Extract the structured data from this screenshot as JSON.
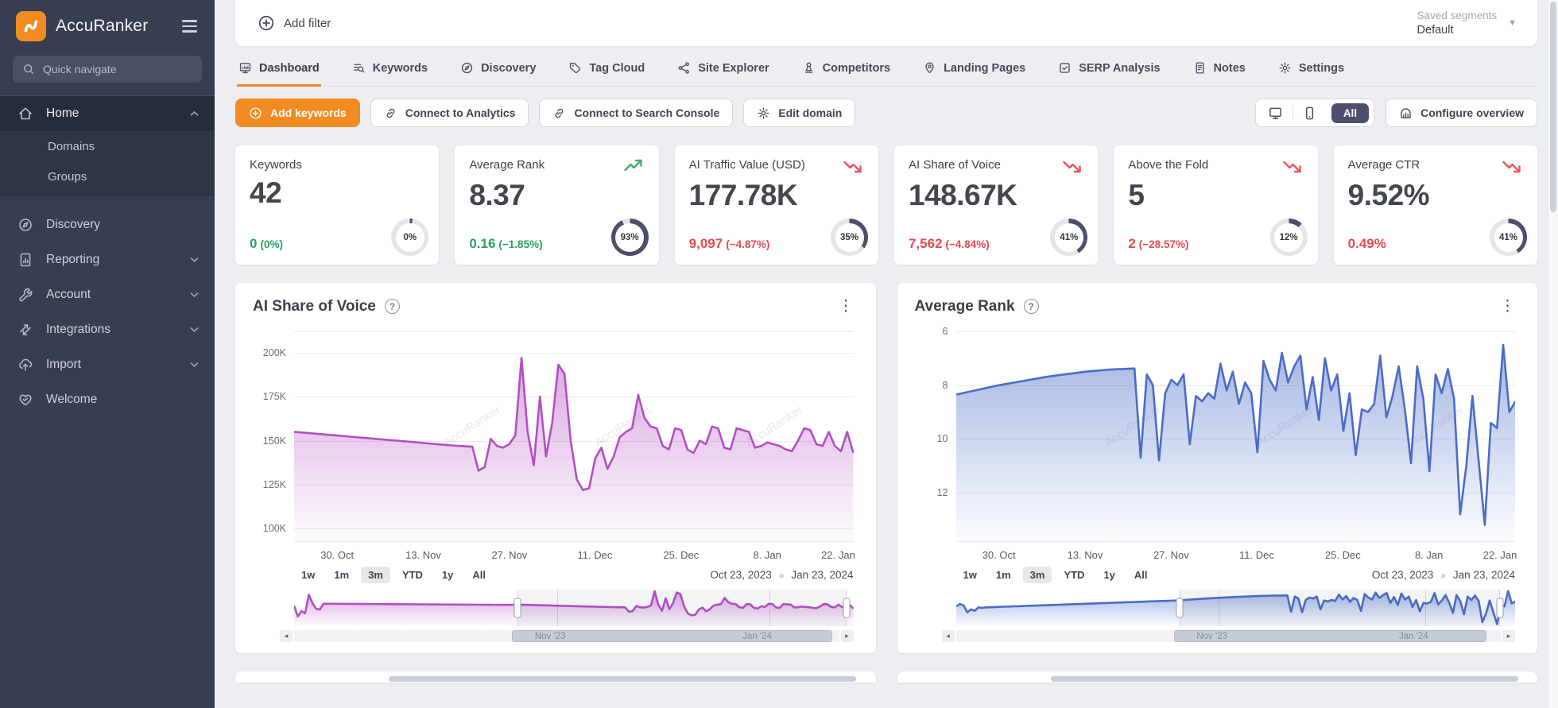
{
  "app": {
    "name": "AccuRanker"
  },
  "colors": {
    "accent_orange": "#f28b21",
    "underline_orange": "#f0861d",
    "navy": "#4b4f6b",
    "green": "#27a163",
    "red": "#e8484f",
    "purple": "#b44fc4",
    "blue": "#4a6cc8"
  },
  "sidebar": {
    "quick_navigate": "Quick navigate",
    "items": [
      {
        "id": "home",
        "label": "Home",
        "icon": "home-icon",
        "active": true,
        "chevron": "up",
        "children": [
          {
            "label": "Domains"
          },
          {
            "label": "Groups"
          }
        ]
      },
      {
        "id": "discovery",
        "label": "Discovery",
        "icon": "compass-icon"
      },
      {
        "id": "reporting",
        "label": "Reporting",
        "icon": "report-icon",
        "chevron": "down"
      },
      {
        "id": "account",
        "label": "Account",
        "icon": "wrench-icon",
        "chevron": "down"
      },
      {
        "id": "integrations",
        "label": "Integrations",
        "icon": "integrations-icon",
        "chevron": "down"
      },
      {
        "id": "import",
        "label": "Import",
        "icon": "import-icon",
        "chevron": "down"
      },
      {
        "id": "welcome",
        "label": "Welcome",
        "icon": "heart-icon"
      }
    ]
  },
  "filter_bar": {
    "add_filter": "Add filter",
    "saved_segments_label": "Saved segments",
    "saved_segments_value": "Default"
  },
  "tabs": [
    {
      "label": "Dashboard",
      "icon": "monitor-icon",
      "active": true
    },
    {
      "label": "Keywords",
      "icon": "list-search-icon"
    },
    {
      "label": "Discovery",
      "icon": "compass-icon"
    },
    {
      "label": "Tag Cloud",
      "icon": "tag-icon"
    },
    {
      "label": "Site Explorer",
      "icon": "sitemap-icon"
    },
    {
      "label": "Competitors",
      "icon": "pawn-icon"
    },
    {
      "label": "Landing Pages",
      "icon": "location-icon"
    },
    {
      "label": "SERP Analysis",
      "icon": "checkbox-icon"
    },
    {
      "label": "Notes",
      "icon": "notes-icon"
    },
    {
      "label": "Settings",
      "icon": "gear-icon"
    }
  ],
  "toolbar": {
    "add_keywords": "Add keywords",
    "secondary": [
      {
        "label": "Connect to Analytics",
        "icon": "link-icon"
      },
      {
        "label": "Connect to Search Console",
        "icon": "link-icon"
      },
      {
        "label": "Edit domain",
        "icon": "gear-icon"
      }
    ],
    "device_toggle": {
      "desktop_icon": "monitor-icon",
      "mobile_icon": "phone-icon",
      "all_label": "All"
    },
    "configure": "Configure overview",
    "configure_icon": "chart-box-icon"
  },
  "metric_cards": [
    {
      "title": "Keywords",
      "value": "42",
      "change_main": "0",
      "change_sub": "(0%)",
      "change_color": "green",
      "trend": null,
      "gauge_pct": 0,
      "gauge_label": "0%"
    },
    {
      "title": "Average Rank",
      "value": "8.37",
      "change_main": "0.16",
      "change_sub": "(−1.85%)",
      "change_color": "green",
      "trend": "up",
      "gauge_pct": 93,
      "gauge_label": "93%"
    },
    {
      "title": "AI Traffic Value (USD)",
      "value": "177.78K",
      "change_main": "9,097",
      "change_sub": "(−4.87%)",
      "change_color": "red",
      "trend": "down",
      "gauge_pct": 35,
      "gauge_label": "35%"
    },
    {
      "title": "AI Share of Voice",
      "value": "148.67K",
      "change_main": "7,562",
      "change_sub": "(−4.84%)",
      "change_color": "red",
      "trend": "down",
      "gauge_pct": 41,
      "gauge_label": "41%"
    },
    {
      "title": "Above the Fold",
      "value": "5",
      "change_main": "2",
      "change_sub": "(−28.57%)",
      "change_color": "red",
      "trend": "down",
      "gauge_pct": 12,
      "gauge_label": "12%"
    },
    {
      "title": "Average CTR",
      "value": "9.52%",
      "change_main": "0.49%",
      "change_sub": "",
      "change_color": "red",
      "trend": "down",
      "gauge_pct": 41,
      "gauge_label": "41%"
    }
  ],
  "chart_data": [
    {
      "type": "area",
      "title": "AI Share of Voice",
      "unit": "K",
      "color": "#b44fc4",
      "inverted": false,
      "y_domain": [
        93,
        212
      ],
      "y_ticks": [
        {
          "label": "200K",
          "value": 200
        },
        {
          "label": "175K",
          "value": 175
        },
        {
          "label": "150K",
          "value": 150
        },
        {
          "label": "125K",
          "value": 125
        },
        {
          "label": "100K",
          "value": 100
        }
      ],
      "x_ticks": [
        {
          "label": "30. Oct",
          "pct": 7.7
        },
        {
          "label": "13. Nov",
          "pct": 23.1
        },
        {
          "label": "27. Nov",
          "pct": 38.5
        },
        {
          "label": "11. Dec",
          "pct": 53.8
        },
        {
          "label": "25. Dec",
          "pct": 69.2
        },
        {
          "label": "8. Jan",
          "pct": 84.6
        },
        {
          "label": "22. Jan",
          "pct": 99.0
        }
      ],
      "values": [
        155,
        154.7,
        154.4,
        154.1,
        153.8,
        153.5,
        153.2,
        152.9,
        152.6,
        152.3,
        152,
        151.7,
        151.4,
        151.1,
        150.8,
        150.5,
        150.2,
        149.9,
        149.6,
        149.3,
        149,
        148.7,
        148.4,
        148.1,
        147.8,
        147.5,
        147.2,
        147,
        146.8,
        146.6,
        133,
        135,
        151,
        147,
        146,
        148,
        153,
        197,
        155,
        136,
        175,
        141,
        160,
        193,
        188,
        150,
        128,
        122,
        123,
        140,
        146,
        134,
        141,
        152,
        155,
        157,
        176,
        163,
        158,
        157,
        147,
        145,
        157,
        156,
        145,
        143,
        150,
        148,
        158,
        157,
        146,
        145,
        157,
        156,
        155,
        146,
        147,
        149,
        148,
        147,
        145,
        144,
        150,
        157,
        156,
        148,
        147,
        155,
        147,
        144,
        155,
        143
      ],
      "range_buttons": [
        "1w",
        "1m",
        "3m",
        "YTD",
        "1y",
        "All"
      ],
      "active_range": "3m",
      "date_from": "Oct 23, 2023",
      "date_separator": "»",
      "date_to": "Jan 23, 2024",
      "watermark": "AccuRanker",
      "navigator": {
        "y_domain": [
          88,
          202
        ],
        "prefix": [
          152,
          118,
          135,
          128,
          186,
          160,
          142,
          140,
          158,
          157.9,
          157.8,
          157.8,
          157.7,
          157.6,
          157.5,
          157.5,
          157.4,
          157.3,
          157.2,
          157.2,
          157.1,
          157,
          156.9,
          156.9,
          156.8,
          156.7,
          156.6,
          156.6,
          156.5,
          156.4,
          156.3,
          156.3,
          156.2,
          156.1,
          156,
          156,
          155.9,
          155.8,
          155.7,
          155.7,
          155.6,
          155.5,
          155.4,
          155.4,
          155.3,
          155.2,
          155.2,
          155.1,
          155,
          155,
          154.9,
          154.8,
          154.8,
          154.7,
          154.6,
          154.6,
          154.5,
          154.4,
          154.4,
          154.3,
          155
        ],
        "selection": [
          40,
          98.8
        ],
        "labels": [
          {
            "text": "Nov '23",
            "pct": 47
          },
          {
            "text": "Jan '24",
            "pct": 85
          }
        ],
        "gridlines": [
          47,
          85
        ]
      }
    },
    {
      "type": "area",
      "title": "Average Rank",
      "unit": "",
      "color": "#4a6cc8",
      "inverted": true,
      "y_domain": [
        6,
        13.8
      ],
      "y_ticks": [
        {
          "label": "6",
          "value": 6
        },
        {
          "label": "8",
          "value": 8
        },
        {
          "label": "10",
          "value": 10
        },
        {
          "label": "12",
          "value": 12
        }
      ],
      "x_ticks": [
        {
          "label": "30. Oct",
          "pct": 7.7
        },
        {
          "label": "13. Nov",
          "pct": 23.1
        },
        {
          "label": "27. Nov",
          "pct": 38.5
        },
        {
          "label": "11. Dec",
          "pct": 53.8
        },
        {
          "label": "25. Dec",
          "pct": 69.2
        },
        {
          "label": "8. Jan",
          "pct": 84.6
        },
        {
          "label": "22. Jan",
          "pct": 99.0
        }
      ],
      "values": [
        8.35,
        8.3,
        8.25,
        8.2,
        8.15,
        8.1,
        8.05,
        8,
        7.96,
        7.92,
        7.88,
        7.84,
        7.8,
        7.76,
        7.72,
        7.68,
        7.65,
        7.62,
        7.59,
        7.56,
        7.53,
        7.5,
        7.48,
        7.46,
        7.44,
        7.42,
        7.41,
        7.4,
        7.39,
        7.38,
        10.7,
        7.6,
        8,
        10.8,
        8.3,
        7.8,
        8,
        7.6,
        10.2,
        8.4,
        8.6,
        8.3,
        8.5,
        7.2,
        8.2,
        7.5,
        8.7,
        7.9,
        8.3,
        10.5,
        7.1,
        7.8,
        8.2,
        6.8,
        7.9,
        7.3,
        6.9,
        8.9,
        7.7,
        9.3,
        7,
        8.2,
        7.6,
        9.7,
        8.3,
        10.6,
        8.9,
        9,
        8.7,
        6.9,
        9.2,
        8.4,
        7.3,
        8.9,
        10.9,
        7.3,
        8.5,
        11.2,
        7.6,
        8.3,
        7.4,
        8.5,
        12.8,
        11,
        8.4,
        10.8,
        13.2,
        9.4,
        9.6,
        6.5,
        9,
        8.6
      ],
      "range_buttons": [
        "1w",
        "1m",
        "3m",
        "YTD",
        "1y",
        "All"
      ],
      "active_range": "3m",
      "date_from": "Oct 23, 2023",
      "date_separator": "»",
      "date_to": "Jan 23, 2024",
      "watermark": "AccuRanker",
      "navigator": {
        "y_domain": [
          6.2,
          13.6
        ],
        "prefix": [
          9.6,
          9.1,
          9.4,
          10.8,
          10.2,
          10.5,
          9.8,
          9.9,
          9.8,
          9.77,
          9.75,
          9.72,
          9.69,
          9.66,
          9.64,
          9.61,
          9.58,
          9.56,
          9.53,
          9.5,
          9.47,
          9.45,
          9.42,
          9.39,
          9.37,
          9.34,
          9.31,
          9.29,
          9.26,
          9.23,
          9.2,
          9.18,
          9.15,
          9.12,
          9.1,
          9.07,
          9.04,
          9.02,
          8.99,
          8.96,
          8.93,
          8.91,
          8.88,
          8.85,
          8.83,
          8.8,
          8.77,
          8.75,
          8.72,
          8.69,
          8.66,
          8.64,
          8.61,
          8.58,
          8.56,
          8.53,
          8.5,
          8.48,
          8.45,
          8.42,
          8.4
        ],
        "selection": [
          40,
          97.3
        ],
        "labels": [
          {
            "text": "Nov '23",
            "pct": 47
          },
          {
            "text": "Jan '24",
            "pct": 84
          }
        ],
        "gridlines": [
          47,
          84
        ]
      }
    }
  ]
}
